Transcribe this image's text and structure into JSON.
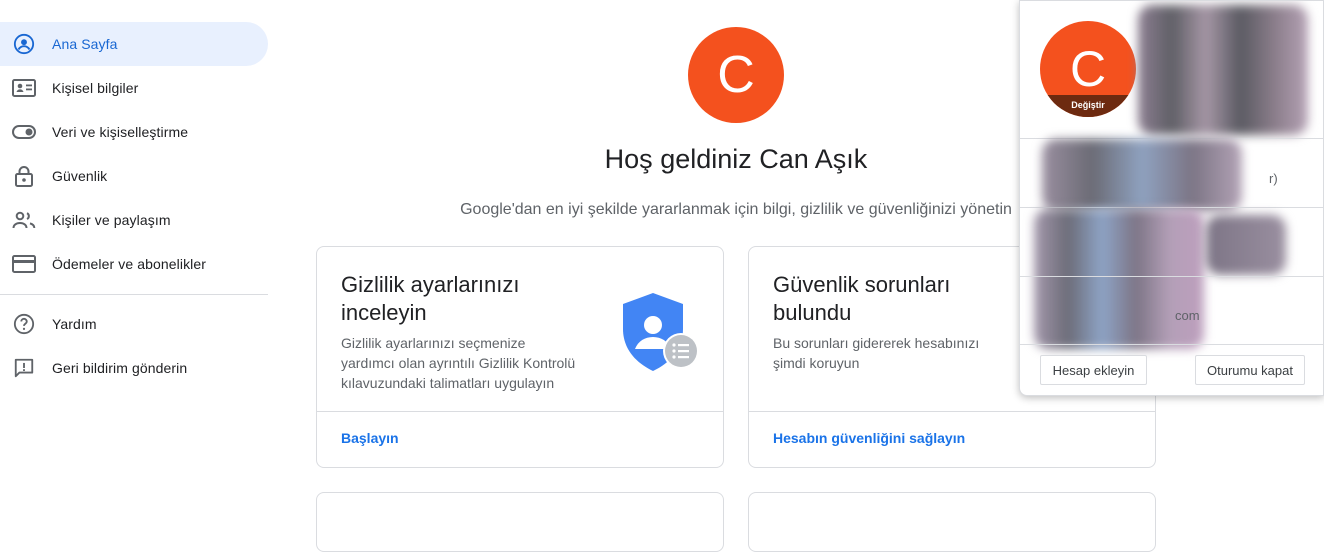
{
  "sidebar": {
    "items": [
      {
        "label": "Ana Sayfa",
        "icon": "account-circle-icon"
      },
      {
        "label": "Kişisel bilgiler",
        "icon": "id-card-icon"
      },
      {
        "label": "Veri ve kişiselleştirme",
        "icon": "toggle-icon"
      },
      {
        "label": "Güvenlik",
        "icon": "lock-icon"
      },
      {
        "label": "Kişiler ve paylaşım",
        "icon": "people-icon"
      },
      {
        "label": "Ödemeler ve abonelikler",
        "icon": "credit-card-icon"
      }
    ],
    "help_items": [
      {
        "label": "Yardım",
        "icon": "help-icon"
      },
      {
        "label": "Geri bildirim gönderin",
        "icon": "feedback-icon"
      }
    ]
  },
  "main": {
    "avatar_letter": "C",
    "welcome": "Hoş geldiniz Can Aşık",
    "subtitle": "Google'dan en iyi şekilde yararlanmak için bilgi, gizlilik ve güvenliğinizi yönetin",
    "cards": [
      {
        "title_line1": "Gizlilik ayarlarınızı",
        "title_line2": "inceleyin",
        "desc_line1": "Gizlilik ayarlarınızı seçmenize",
        "desc_line2": "yardımcı olan ayrıntılı Gizlilik Kontrolü",
        "desc_line3": "kılavuzundaki talimatları uygulayın",
        "link": "Başlayın"
      },
      {
        "title_line1": "Güvenlik sorunları",
        "title_line2": "bulundu",
        "desc_line1": "Bu sorunları gidererek hesabınızı",
        "desc_line2": "şimdi koruyun",
        "link": "Hesabın güvenliğini sağlayın"
      }
    ]
  },
  "account_panel": {
    "avatar_letter": "C",
    "change_label": "Değiştir",
    "partial_text_1": "r)",
    "partial_text_2": "com",
    "add_account": "Hesap ekleyin",
    "sign_out": "Oturumu kapat"
  },
  "colors": {
    "accent": "#1a73e8",
    "active_bg": "#e8f0fe",
    "avatar": "#f4511e",
    "shield": "#4285f4"
  }
}
